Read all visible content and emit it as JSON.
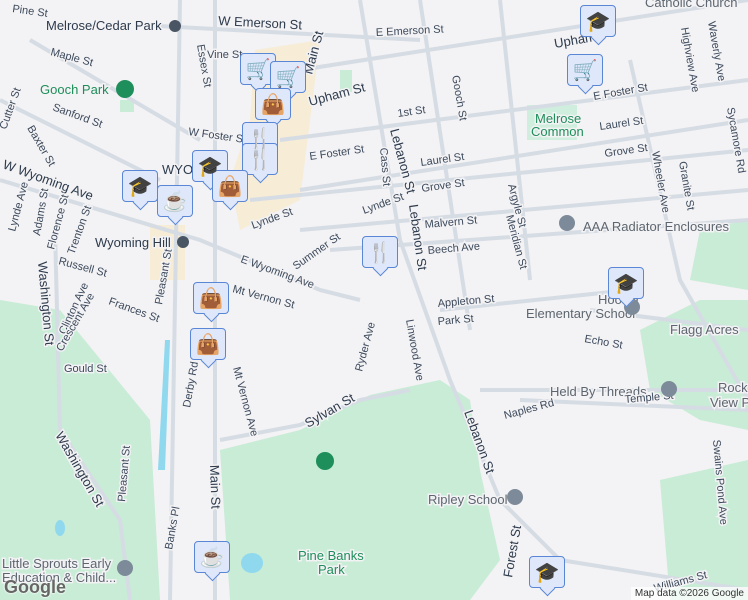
{
  "labels": [
    "Pine St",
    "W Emerson St",
    "E Emerson St",
    "Melrose/Cedar Park",
    "Maple St",
    "Vine St",
    "Essex St",
    "Main St",
    "Upham St",
    "Upham",
    "Gooch Park",
    "Sanford St",
    "Cutter St",
    "Baxter St",
    "W Foster St",
    "E Foster St",
    "E Foster St",
    "1st St",
    "Laurel St",
    "Laurel St",
    "Melrose",
    "Common",
    "Grove St",
    "Grove St",
    "Gooch St",
    "Lebanon St",
    "Lebanon St",
    "Cass St",
    "Lynde St",
    "Malvern St",
    "Beech Ave",
    "Argyle St",
    "Meridian St",
    "AAA Radiator Enclosures",
    "Wheeler Ave",
    "Granite St",
    "Highview Ave",
    "Waverly Ave",
    "Sycamore Rd",
    "Catholic Church",
    "WYO",
    "W Wyoming Ave",
    "Lynde Ave",
    "Adams St",
    "Florence St",
    "Trenton St",
    "Wyoming Hill",
    "Russell St",
    "Lynde St",
    "Summer St",
    "E Wyoming Ave",
    "Mt Vernon St",
    "Pleasant St",
    "Derby Rd",
    "Clinton Ave",
    "Frances St",
    "Crescent Ave",
    "Gould St",
    "Washington St",
    "Washington St",
    "Pleasant St",
    "Banks Pl",
    "Main St",
    "Mt Vernon Ave",
    "Sylvan St",
    "Ryder Ave",
    "Linwood Ave",
    "Appleton St",
    "Park St",
    "Hoover",
    "Elementary School",
    "Echo St",
    "Flagg Acres",
    "Held By Threads",
    "Rock",
    "View P",
    "Naples Rd",
    "Temple St",
    "Lebanon St",
    "Ripley School",
    "Swains Pond Ave",
    "Forest St",
    "Pine Banks",
    "Park",
    "Little Sprouts Early",
    "Education & Child...",
    "Williams St",
    "Essex St",
    "Main St",
    "Derby Rd"
  ],
  "markers": [
    {
      "type": "school",
      "glyph": "🎓"
    },
    {
      "type": "shopping",
      "glyph": "🛒"
    },
    {
      "type": "shopping",
      "glyph": "🛒"
    },
    {
      "type": "shopping",
      "glyph": "🛒"
    },
    {
      "type": "shopping-bag",
      "glyph": "👜"
    },
    {
      "type": "restaurant",
      "glyph": "🍴"
    },
    {
      "type": "restaurant",
      "glyph": "🍴"
    },
    {
      "type": "school",
      "glyph": "🎓"
    },
    {
      "type": "shopping-bag",
      "glyph": "👜"
    },
    {
      "type": "school",
      "glyph": "🎓"
    },
    {
      "type": "cafe",
      "glyph": "☕"
    },
    {
      "type": "restaurant",
      "glyph": "🍴"
    },
    {
      "type": "school",
      "glyph": "🎓"
    },
    {
      "type": "shopping-bag",
      "glyph": "👜"
    },
    {
      "type": "shopping-bag",
      "glyph": "👜"
    },
    {
      "type": "cafe",
      "glyph": "☕"
    },
    {
      "type": "school",
      "glyph": "🎓"
    }
  ],
  "attribution": "Map data ©2026 Google",
  "logo": "Google"
}
